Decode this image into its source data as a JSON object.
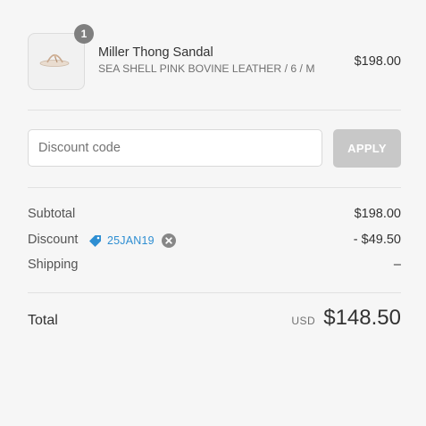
{
  "product": {
    "quantity": "1",
    "name": "Miller Thong Sandal",
    "variant": "SEA SHELL PINK BOVINE LEATHER / 6 / M",
    "price": "$198.00"
  },
  "discount_form": {
    "placeholder": "Discount code",
    "value": "",
    "apply_label": "APPLY"
  },
  "summary": {
    "subtotal_label": "Subtotal",
    "subtotal_value": "$198.00",
    "discount_label": "Discount",
    "discount_code": "25JAN19",
    "discount_value": "- $49.50",
    "shipping_label": "Shipping",
    "shipping_value": "–"
  },
  "total": {
    "label": "Total",
    "currency": "USD",
    "amount": "$148.50"
  },
  "colors": {
    "background": "#f6f6f6",
    "accent_link": "#2e8ed2",
    "apply_button_disabled": "#c8c8c8",
    "badge": "#7f7f7f"
  },
  "icons": {
    "tag": "price-tag-icon",
    "remove": "close-circle-icon"
  }
}
